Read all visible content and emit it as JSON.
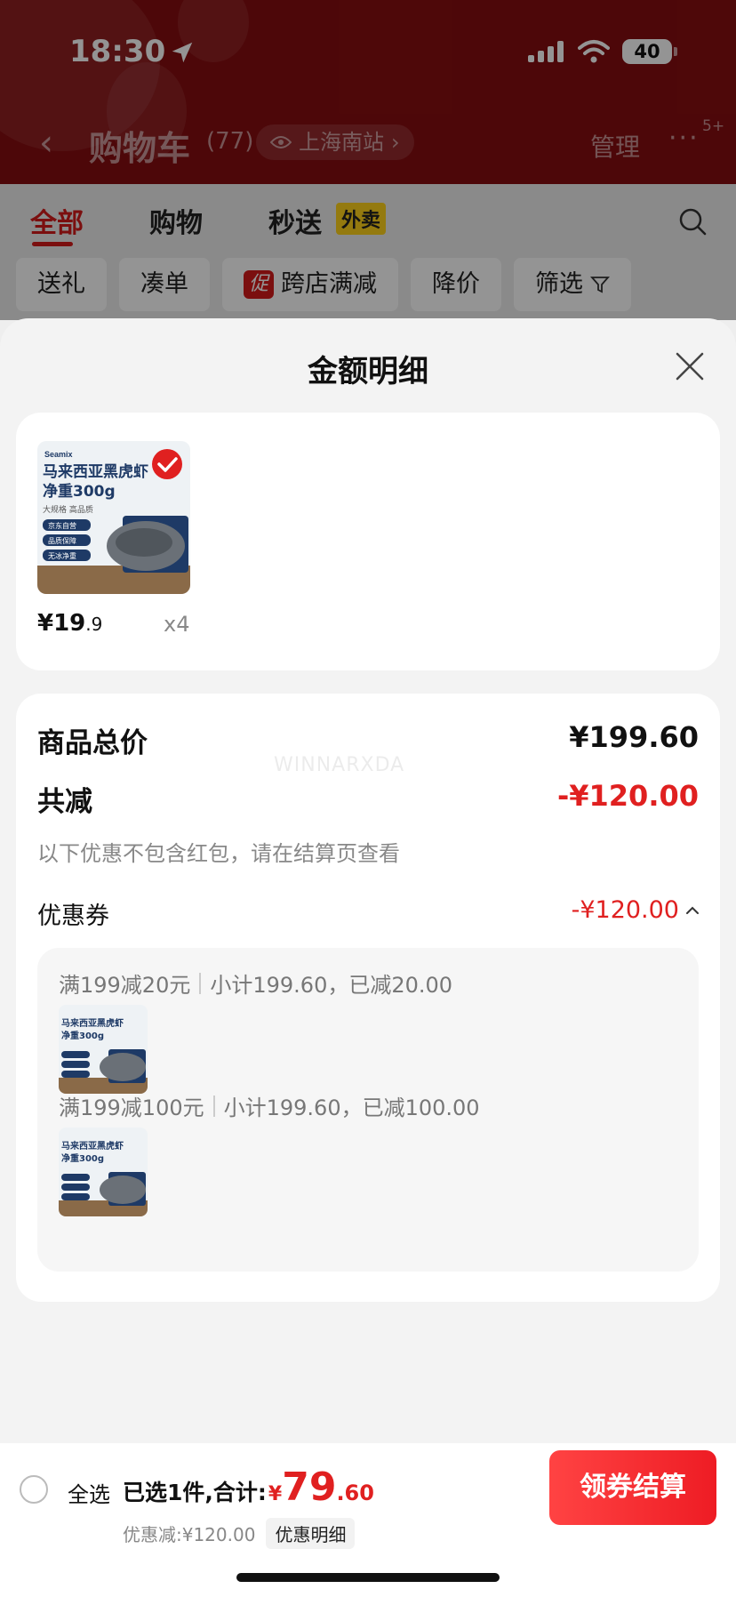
{
  "status_bar": {
    "time": "18:30",
    "battery": "40"
  },
  "nav": {
    "title": "购物车",
    "count": "(77)",
    "location": "上海南站",
    "manage": "管理",
    "more_badge": "5+"
  },
  "tabs": [
    {
      "label": "全部"
    },
    {
      "label": "购物"
    },
    {
      "label": "秒送"
    }
  ],
  "takeout_badge": "外卖",
  "chips": {
    "gift": "送礼",
    "bundle": "凑单",
    "promo_tag": "促",
    "cross_store": "跨店满减",
    "price_drop": "降价",
    "filter": "筛选"
  },
  "sheet": {
    "title": "金额明细",
    "product": {
      "price_int": "¥19",
      "price_dec": ".9",
      "qty": "x4"
    },
    "summary": {
      "total_label": "商品总价",
      "total_value": "¥199.60",
      "reduce_label": "共减",
      "reduce_value": "-¥120.00",
      "note": "以下优惠不包含红包，请在结算页查看",
      "coupon_label": "优惠券",
      "coupon_value": "-¥120.00"
    },
    "coupon_rules": [
      {
        "rule": "满199减20元",
        "subtotal": "小计199.60，已减20.00"
      },
      {
        "rule": "满199减100元",
        "subtotal": "小计199.60，已减100.00"
      }
    ],
    "watermark": "WINNARXDA"
  },
  "product_image": {
    "brand": "Seamix",
    "name": "马来西亚黑虎虾",
    "weight": "净重300g",
    "tags": [
      "京东自营",
      "品质保障",
      "无冰净重"
    ],
    "subtitle": "大规格 高品质"
  },
  "bottom_bar": {
    "select_all": "全选",
    "selected": "已选1件,合计:",
    "total_yuan": "¥",
    "total_int": "79",
    "total_dec": ".60",
    "discount": "优惠减:¥120.00",
    "detail": "优惠明细",
    "checkout": "领券结算"
  },
  "colors": {
    "accent": "#e02020",
    "header_bg": "#860d10",
    "takeout": "#ffd21a"
  }
}
